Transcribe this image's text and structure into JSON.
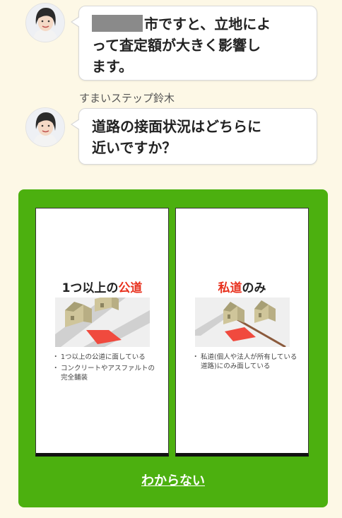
{
  "chat": {
    "message1": {
      "redacted_prefix": "",
      "line1": "市ですと、立地によ",
      "line2": "って査定額が大きく影響し",
      "line3": "ます。"
    },
    "sender_name": "すまいステップ鈴木",
    "message2": {
      "line1": "道路の接面状況はどちらに",
      "line2": "近いですか？"
    }
  },
  "options": {
    "public_road": {
      "title_prefix": "1つ以上の",
      "title_highlight": "公道",
      "notes": [
        "1つ以上の公道に面している",
        "コンクリートやアスファルトの完全舗装"
      ]
    },
    "private_road": {
      "title_highlight": "私道",
      "title_suffix": "のみ",
      "notes": [
        "私道(個人や法人が所有している道路)にのみ面している"
      ]
    },
    "unknown_label": "わからない"
  },
  "colors": {
    "background": "#fdf8e6",
    "panel_green": "#4cb00f",
    "highlight_red": "#e8321f",
    "plot_red": "#f04a3e"
  },
  "icons": {
    "avatar": "woman-avatar-icon",
    "public_illustration": "public-road-house-illustration",
    "private_illustration": "private-road-house-illustration"
  }
}
